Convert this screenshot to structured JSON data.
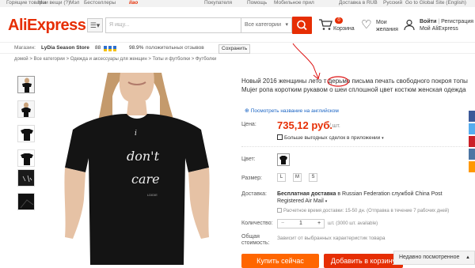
{
  "topbar": {
    "items": [
      "Горящие товары",
      "Мои вещи (?)",
      "Мэл",
      "Бестселлеры",
      "Покупателя",
      "Помощь",
      "Мобильное прил",
      "Доставка в RUB",
      "Русский",
      "Go to Global Site (English)"
    ],
    "doodle": "ilao"
  },
  "header": {
    "logo": "AliExpress",
    "search_placeholder": "Я ищу...",
    "category": "Все категории",
    "cart_count": "0",
    "cart_label": "Корзина",
    "wish_line1": "Мои",
    "wish_line2": "желания",
    "signin": "Войти",
    "register": "Регистрация",
    "account": "Мой AliExpress"
  },
  "store": {
    "label": "Магазин:",
    "name": "LyDia Season Store",
    "score": "88",
    "feedback_pct": "98.9%",
    "feedback_label": "положительных отзывов",
    "save": "Сохранить"
  },
  "breadcrumbs": "домой > Все категории > Одежда и аксессуары для женщин > Топы и футболки > Футболки",
  "product": {
    "title": "Новый 2016 женщины лето т дерьмо письма печать свободного покроя топы Mujer ропа коротким рукавом о шеи сплошной цвет костюм женская одежда",
    "translate_link": "Посмотреть название на английском",
    "price_label": "Цена:",
    "price": "735,12 руб.",
    "unit": "/ шт.",
    "deals": "Больше выгодных сделок в приложении",
    "color_label": "Цвет:",
    "size_label": "Размер:",
    "sizes": [
      "L",
      "M",
      "S"
    ],
    "shipping_label": "Доставка:",
    "shipping_bold": "Бесплатная доставка",
    "shipping_rest": " в Russian Federation службой China Post Registered Air Mail",
    "shipping_sub": "Расчетное время доставки: 15-50 дн. (Отправка в течение 7 рабочих дней)",
    "qty_label": "Количество:",
    "qty_minus": "−",
    "qty_value": "1",
    "qty_plus": "+",
    "qty_note": "шт. (3000 шт. available)",
    "total_label1": "Общая",
    "total_label2": "стоимость:",
    "total_note": "Зависит от выбранных характеристик товара",
    "buy_now": "Купить сейчас",
    "add_to_cart": "Добавить в корзину",
    "shirt_line1": "i",
    "shirt_line2": "don't",
    "shirt_line3": "care",
    "shirt_small": "LDIDIE"
  },
  "recently_viewed": "Недавно посмотренное",
  "colors": {
    "accent": "#e62e04",
    "buy": "#ff6600",
    "link": "#1a64c4"
  }
}
